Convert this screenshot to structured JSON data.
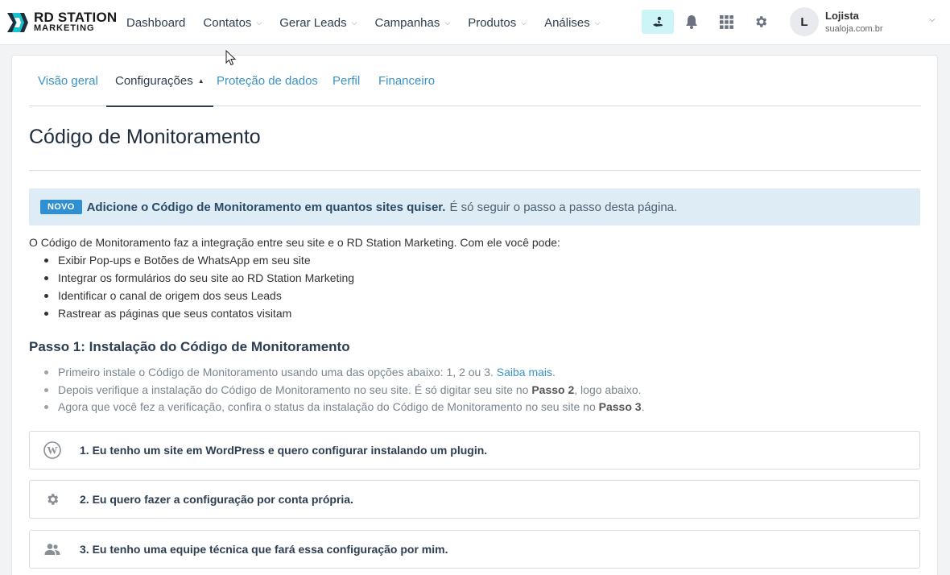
{
  "brand": {
    "name": "RD STATION",
    "sub": "MARKETING"
  },
  "nav": {
    "items": [
      {
        "label": "Dashboard",
        "dropdown": false
      },
      {
        "label": "Contatos",
        "dropdown": true
      },
      {
        "label": "Gerar Leads",
        "dropdown": true
      },
      {
        "label": "Campanhas",
        "dropdown": true
      },
      {
        "label": "Produtos",
        "dropdown": true
      },
      {
        "label": "Análises",
        "dropdown": true
      }
    ]
  },
  "icons": {
    "help": "help-hand-icon",
    "notifications": "bell-icon",
    "apps": "grid-icon",
    "settings": "gear-icon"
  },
  "user": {
    "initial": "L",
    "name": "Lojista",
    "domain": "sualoja.com.br"
  },
  "tabs": [
    {
      "label": "Visão geral",
      "active": false
    },
    {
      "label": "Configurações",
      "active": true
    },
    {
      "label": "Proteção de dados",
      "active": false
    },
    {
      "label": "Perfil",
      "active": false
    },
    {
      "label": "Financeiro",
      "active": false
    }
  ],
  "page": {
    "title": "Código de Monitoramento"
  },
  "banner": {
    "badge": "NOVO",
    "strong": "Adicione o Código de Monitoramento em quantos sites quiser.",
    "text": "É só seguir o passo a passo desta página."
  },
  "intro": {
    "text": "O Código de Monitoramento faz a integração entre seu site e o RD Station Marketing. Com ele você pode:",
    "features": [
      "Exibir Pop-ups e Botões de WhatsApp em seu site",
      "Integrar os formulários do seu site ao RD Station Marketing",
      "Identificar o canal de origem dos seus Leads",
      "Rastrear as páginas que seus contatos visitam"
    ]
  },
  "step1": {
    "title": "Passo 1: Instalação do Código de Monitoramento",
    "line1": {
      "text": "Primeiro instale o Código de Monitoramento usando uma das opções abaixo: 1, 2 ou 3.",
      "link": "Saiba mais",
      "end": "."
    },
    "line2": {
      "a": "Depois verifique a instalação do Código de Monitoramento no seu site. É só digitar seu site no",
      "b": "Passo 2",
      "c": ", logo abaixo."
    },
    "line3": {
      "a": "Agora que você fez a verificação, confira o status da instalação do Código de Monitoramento no seu site no",
      "b": "Passo 3",
      "c": "."
    }
  },
  "options": [
    {
      "label": "1. Eu tenho um site em WordPress e quero configurar instalando um plugin.",
      "icon": "wordpress-icon"
    },
    {
      "label": "2. Eu quero fazer a configuração por conta própria.",
      "icon": "gear-icon"
    },
    {
      "label": "3. Eu tenho uma equipe técnica que fará essa configuração por mim.",
      "icon": "users-icon"
    }
  ],
  "colors": {
    "accent": "#3a93c7",
    "badge": "#2f8fd1",
    "banner_bg": "#deedf5",
    "help_bg": "#cdf4f7"
  }
}
